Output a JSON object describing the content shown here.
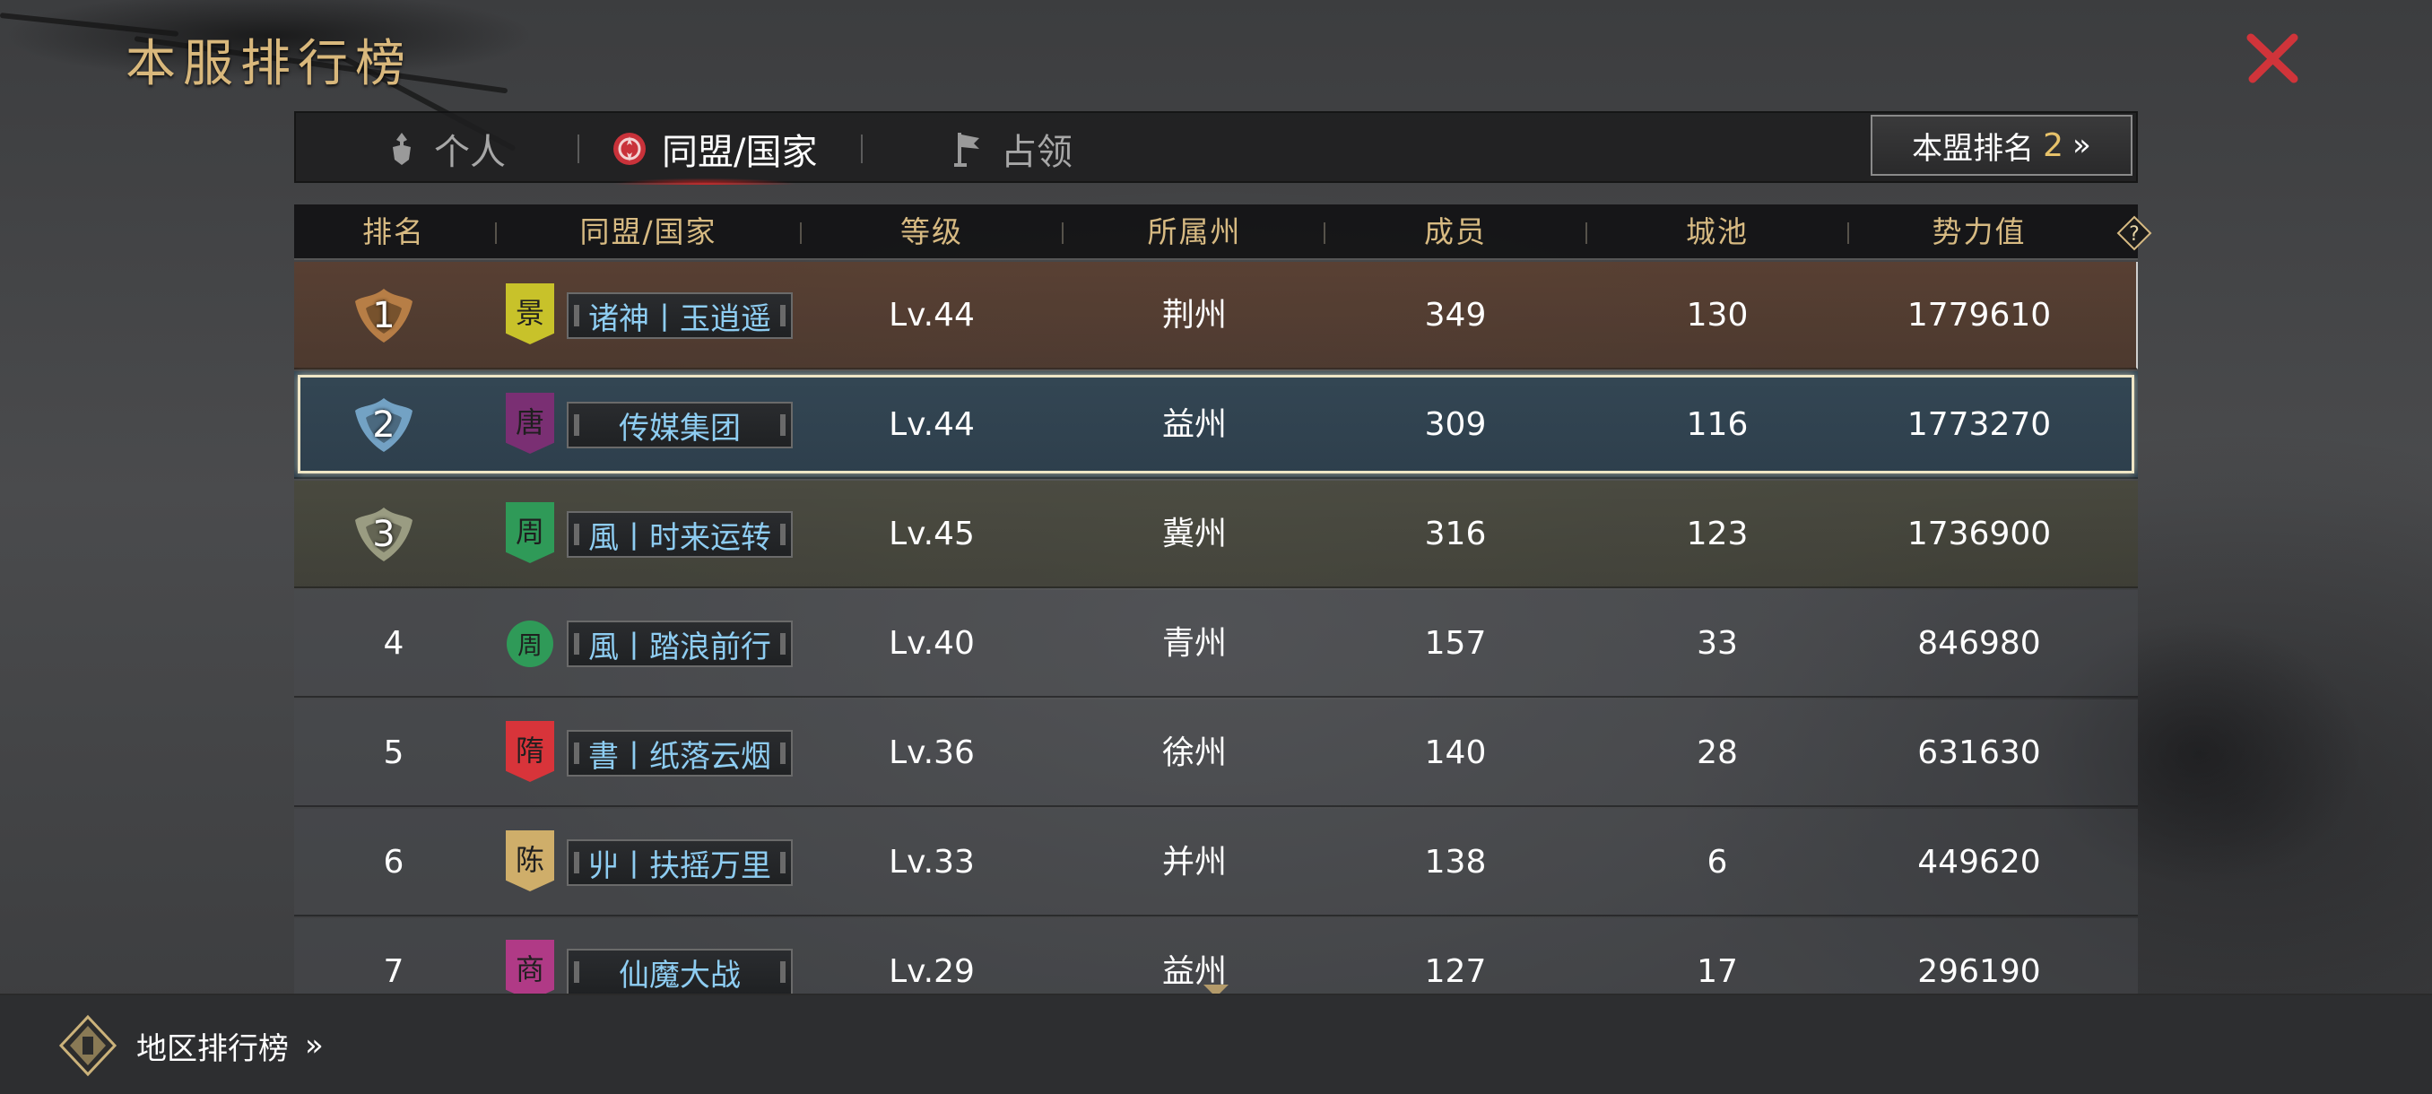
{
  "page": {
    "title": "本服排行榜"
  },
  "tabs": [
    {
      "label": "个人",
      "icon": "person-icon",
      "active": false
    },
    {
      "label": "同盟/国家",
      "icon": "alliance-emblem-icon",
      "active": true
    },
    {
      "label": "占领",
      "icon": "flag-icon",
      "active": false
    }
  ],
  "rank_button": {
    "label": "本盟排名",
    "value": "2",
    "arrow": "»"
  },
  "table": {
    "headers": [
      "排名",
      "同盟/国家",
      "等级",
      "所属州",
      "成员",
      "城池",
      "势力值"
    ],
    "help_symbol": "?",
    "rows": [
      {
        "rank": "1",
        "flag_char": "景",
        "flag_color": "#c8c22a",
        "flag_shape": "banner",
        "name": "诸神丨玉逍遥",
        "level": "Lv.44",
        "state": "荆州",
        "members": "349",
        "cities": "130",
        "power": "1779610"
      },
      {
        "rank": "2",
        "flag_char": "唐",
        "flag_color": "#7a2f73",
        "flag_shape": "banner",
        "name": "传媒集团",
        "level": "Lv.44",
        "state": "益州",
        "members": "309",
        "cities": "116",
        "power": "1773270"
      },
      {
        "rank": "3",
        "flag_char": "周",
        "flag_color": "#2f9a58",
        "flag_shape": "banner",
        "name": "風丨时来运转",
        "level": "Lv.45",
        "state": "冀州",
        "members": "316",
        "cities": "123",
        "power": "1736900"
      },
      {
        "rank": "4",
        "flag_char": "周",
        "flag_color": "#2f9a58",
        "flag_shape": "round",
        "name": "風丨踏浪前行",
        "level": "Lv.40",
        "state": "青州",
        "members": "157",
        "cities": "33",
        "power": "846980"
      },
      {
        "rank": "5",
        "flag_char": "隋",
        "flag_color": "#d8343a",
        "flag_shape": "banner",
        "name": "書丨纸落云烟",
        "level": "Lv.36",
        "state": "徐州",
        "members": "140",
        "cities": "28",
        "power": "631630"
      },
      {
        "rank": "6",
        "flag_char": "陈",
        "flag_color": "#cfae6a",
        "flag_shape": "banner",
        "name": "丱丨扶摇万里",
        "level": "Lv.33",
        "state": "并州",
        "members": "138",
        "cities": "6",
        "power": "449620"
      },
      {
        "rank": "7",
        "flag_char": "商",
        "flag_color": "#b03a86",
        "flag_shape": "banner",
        "name": "仙魔大战",
        "level": "Lv.29",
        "state": "益州",
        "members": "127",
        "cities": "17",
        "power": "296190"
      }
    ]
  },
  "bottom": {
    "region_label": "地区排行榜",
    "arrow": "»"
  },
  "colors": {
    "gold": "#d7ba82",
    "alliance_name": "#8ecdf2",
    "tab_highlight": "#d22828",
    "close": "#d0343a"
  }
}
